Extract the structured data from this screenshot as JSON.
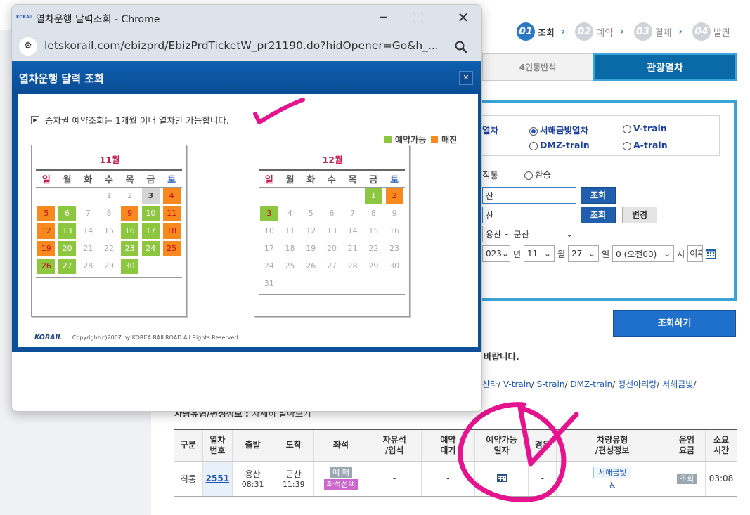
{
  "steps": [
    {
      "num": "01",
      "label": "조회"
    },
    {
      "num": "02",
      "label": "예약"
    },
    {
      "num": "03",
      "label": "결제"
    },
    {
      "num": "04",
      "label": "발권"
    }
  ],
  "tabs": {
    "seat4": "4인동반석",
    "tour": "관광열차"
  },
  "train_options": {
    "partial_label": "열차",
    "seohae": "서해금빛열차",
    "vtrain": "V-train",
    "dmz": "DMZ-train",
    "atrain": "A-train"
  },
  "trip": {
    "direct": "직통",
    "transfer": "환승"
  },
  "stations": {
    "dep_partial": "산",
    "arr_partial": "산",
    "search_btn": "조회",
    "swap_btn": "변경",
    "route": "용산 ~ 군산"
  },
  "date": {
    "year": "023",
    "year_unit": "년",
    "month": "11",
    "month_unit": "월",
    "day": "27",
    "day_unit": "일",
    "hour": "0 (오전00)",
    "hour_unit": "시",
    "after": "이후"
  },
  "search_button": "조회하기",
  "notice_partial": "바랍니다.",
  "links": [
    "산타",
    "V-train",
    "S-train",
    "DMZ-train",
    "정선아리랑",
    "서해금빛"
  ],
  "car_info": {
    "label": "차량유형/편성정보 :",
    "link": "자세히 알아보기"
  },
  "table": {
    "headers": [
      "구분",
      "열차\n번호",
      "출발",
      "도착",
      "좌석",
      "자유석\n/입석",
      "예약\n대기",
      "예약가능\n일자",
      "경유",
      "차량유형\n/편성정보",
      "운임\n요금",
      "소요\n시간"
    ],
    "row": {
      "type": "직통",
      "train_no": "2551",
      "dep_station": "용산",
      "dep_time": "08:31",
      "arr_station": "군산",
      "arr_time": "11:39",
      "seat_btn": "예 매",
      "seat_select": "좌석선택",
      "free": "-",
      "wait": "-",
      "via": "-",
      "car_type": "서해금빛",
      "fare_btn": "조회",
      "duration": "03:08"
    }
  },
  "popup": {
    "window_title": "열차운행 달력조회 - Chrome",
    "favicon": "KORAIL",
    "url": "letskorail.com/ebizprd/EbizPrdTicketW_pr21190.do?hidOpener=Go&h_...",
    "header": "열차운행 달력 조회",
    "notice": "승차권 예약조회는 1개월 이내 열차만 가능합니다.",
    "legend": {
      "available": "예약가능",
      "soldout": "매진",
      "available_color": "#8dc63f",
      "soldout_color": "#f7891f"
    },
    "weekdays": [
      "일",
      "월",
      "화",
      "수",
      "목",
      "금",
      "토"
    ],
    "months": [
      {
        "title": "11월",
        "weeks": [
          [
            null,
            null,
            null,
            {
              "d": "1"
            },
            {
              "d": "2"
            },
            {
              "d": "3",
              "s": "gr"
            },
            {
              "d": "4",
              "s": "o"
            }
          ],
          [
            {
              "d": "5",
              "s": "o"
            },
            {
              "d": "6",
              "s": "g"
            },
            {
              "d": "7"
            },
            {
              "d": "8"
            },
            {
              "d": "9",
              "s": "o"
            },
            {
              "d": "10",
              "s": "g"
            },
            {
              "d": "11",
              "s": "o"
            }
          ],
          [
            {
              "d": "12",
              "s": "o"
            },
            {
              "d": "13",
              "s": "g"
            },
            {
              "d": "14"
            },
            {
              "d": "15"
            },
            {
              "d": "16",
              "s": "g"
            },
            {
              "d": "17",
              "s": "g"
            },
            {
              "d": "18",
              "s": "o"
            }
          ],
          [
            {
              "d": "19",
              "s": "o"
            },
            {
              "d": "20",
              "s": "g"
            },
            {
              "d": "21"
            },
            {
              "d": "22"
            },
            {
              "d": "23",
              "s": "g"
            },
            {
              "d": "24",
              "s": "g"
            },
            {
              "d": "25",
              "s": "o"
            }
          ],
          [
            {
              "d": "26",
              "s": "g red"
            },
            {
              "d": "27",
              "s": "g"
            },
            {
              "d": "28"
            },
            {
              "d": "29"
            },
            {
              "d": "30",
              "s": "g"
            },
            null,
            null
          ]
        ]
      },
      {
        "title": "12월",
        "weeks": [
          [
            null,
            null,
            null,
            null,
            null,
            {
              "d": "1",
              "s": "g"
            },
            {
              "d": "2",
              "s": "o"
            }
          ],
          [
            {
              "d": "3",
              "s": "g red"
            },
            {
              "d": "4"
            },
            {
              "d": "5"
            },
            {
              "d": "6"
            },
            {
              "d": "7"
            },
            {
              "d": "8"
            },
            {
              "d": "9"
            }
          ],
          [
            {
              "d": "10"
            },
            {
              "d": "11"
            },
            {
              "d": "12"
            },
            {
              "d": "13"
            },
            {
              "d": "14"
            },
            {
              "d": "15"
            },
            {
              "d": "16"
            }
          ],
          [
            {
              "d": "17"
            },
            {
              "d": "18"
            },
            {
              "d": "19"
            },
            {
              "d": "20"
            },
            {
              "d": "21"
            },
            {
              "d": "22"
            },
            {
              "d": "23"
            }
          ],
          [
            {
              "d": "24"
            },
            {
              "d": "25"
            },
            {
              "d": "26"
            },
            {
              "d": "27"
            },
            {
              "d": "28"
            },
            {
              "d": "29"
            },
            {
              "d": "30"
            }
          ],
          [
            {
              "d": "31"
            },
            null,
            null,
            null,
            null,
            null,
            null
          ]
        ]
      }
    ],
    "footer_logo": "KORAIL",
    "copyright": "Copyright(c)2007 by KOREA RAILROAD All Rights Reserved."
  },
  "colors": {
    "accent": "#2b78c5",
    "annotation": "#e5138e"
  }
}
